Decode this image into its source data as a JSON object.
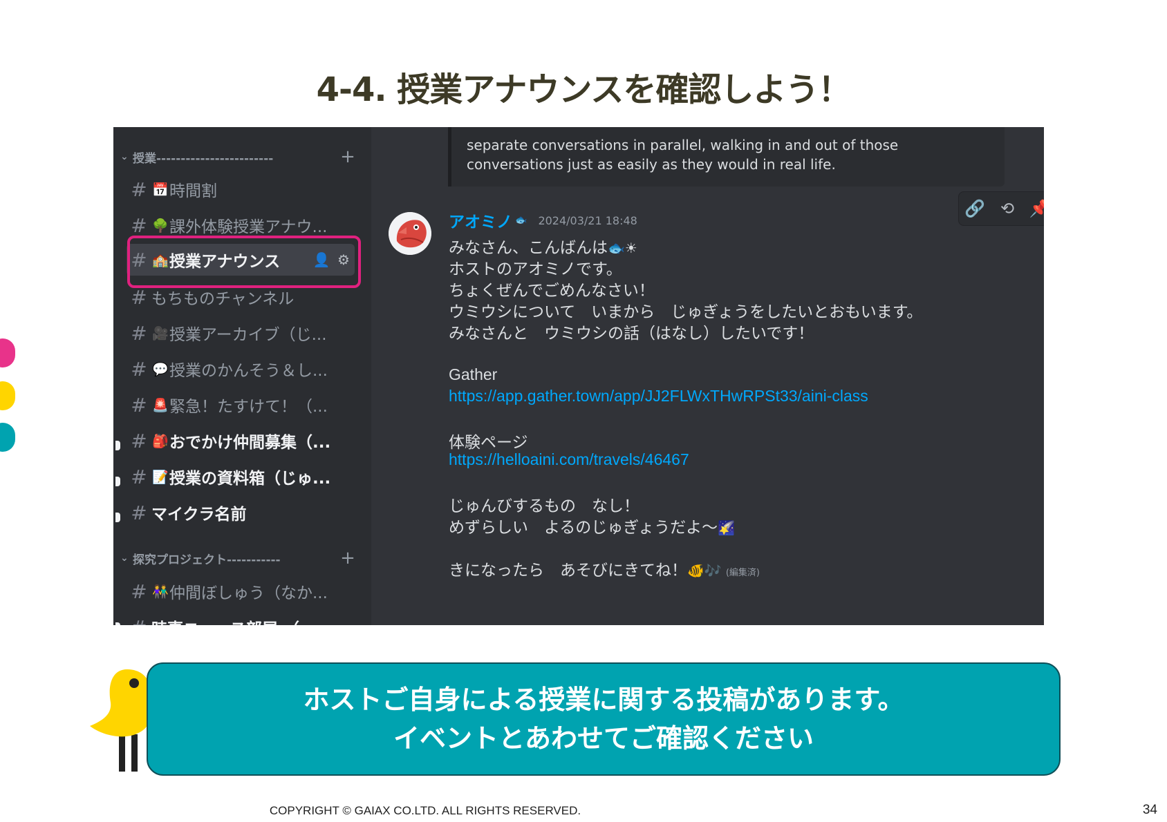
{
  "page": {
    "title": "4-4. 授業アナウンスを確認しよう！",
    "copyright": "COPYRIGHT © GAIAX CO.LTD. ALL RIGHTS RESERVED.",
    "page_number": "34"
  },
  "sidebar": {
    "categories": [
      {
        "label": "授業------------------------",
        "plus": "+"
      },
      {
        "label": "探究プロジェクト-----------",
        "plus": "+"
      }
    ],
    "channels": [
      {
        "emoji": "📅",
        "name": "時間割"
      },
      {
        "emoji": "🌳",
        "name": "課外体験授業アナウ..."
      },
      {
        "emoji": "🏫",
        "name": "授業アナウンス"
      },
      {
        "emoji": "",
        "name": "もちものチャンネル"
      },
      {
        "emoji": "🎥",
        "name": "授業アーカイブ（じ..."
      },
      {
        "emoji": "💬",
        "name": "授業のかんそう＆し..."
      },
      {
        "emoji": "🚨",
        "name": "緊急！たすけて！（..."
      },
      {
        "emoji": "🎒",
        "name": "おでかけ仲間募集（..."
      },
      {
        "emoji": "📝",
        "name": "授業の資料箱（じゅ..."
      },
      {
        "emoji": "",
        "name": "マイクラ名前"
      },
      {
        "emoji": "👫",
        "name": "仲間ぼしゅう（なか..."
      },
      {
        "emoji": "🌍",
        "name": "時事ニュース部屋 （"
      }
    ],
    "hash": "#"
  },
  "chat": {
    "embed_lines": "separate conversations in parallel, walking in and out of those\nconversations just as easily as they would in real life.",
    "message": {
      "author": "アオミノ",
      "badge": "🐟",
      "timestamp": "2024/03/21 18:48",
      "lines": [
        "みなさん、こんばんは",
        "ホストのアオミノです。",
        "ちょくぜんでごめんなさい！",
        "ウミウシについて　いまから　じゅぎょうをしたいとおもいます。",
        "みなさんと　ウミウシの話（はなし）したいです！",
        "Gather",
        "https://app.gather.town/app/JJ2FLWxTHwRPSt33/aini-class",
        "体験ページ",
        "https://helloaini.com/travels/46467",
        "じゅんびするもの　なし！",
        "めずらしい　よるのじゅぎょうだよ〜",
        "きになったら　あそびにきてね！"
      ],
      "emoji_greeting": "🐟☀",
      "emoji_night": "🌠",
      "emoji_end": "🐠🎶",
      "edited": "(編集済)"
    },
    "toolbar": {
      "link_icon": "🔗",
      "thread_icon": "⟲",
      "pin_icon": "📌"
    }
  },
  "callout": {
    "line1": "ホストご自身による授業に関する投稿があります。",
    "line2": "イベントとあわせてご確認ください"
  },
  "colors": {
    "discord_bg": "#313338",
    "sidebar_bg": "#2b2d31",
    "highlight_border": "#e0217f",
    "callout_bg": "#00a3b0",
    "link": "#00a8fc",
    "dot_pink": "#e8338a",
    "dot_yellow": "#ffd500",
    "dot_teal": "#00a3b0"
  }
}
